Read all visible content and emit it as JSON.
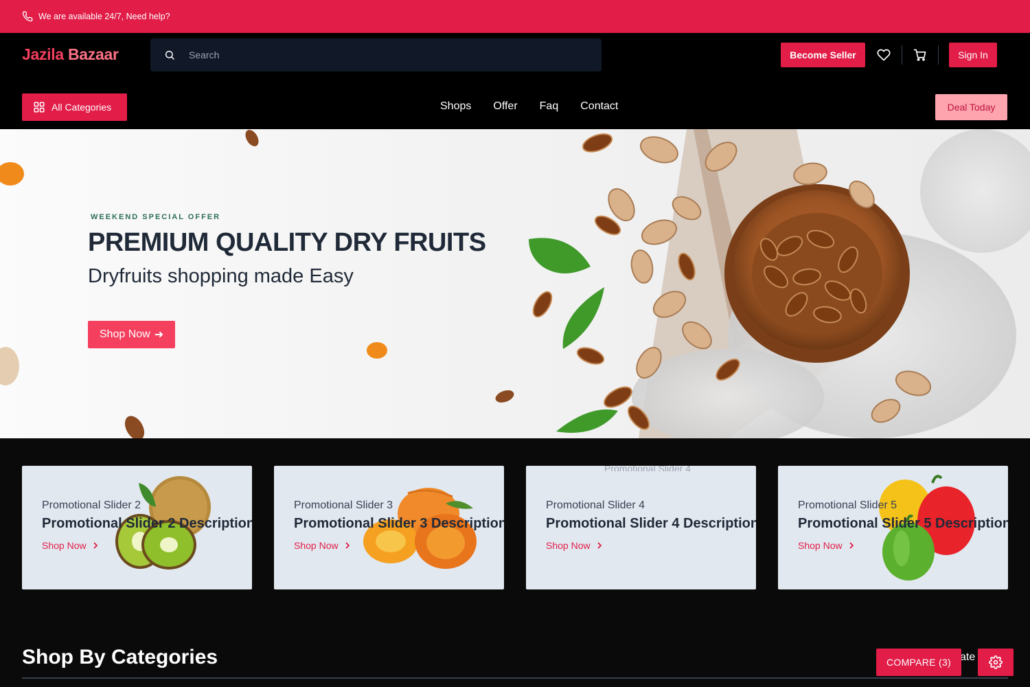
{
  "topbar": {
    "text": "We are available 24/7, Need help?",
    "icon": "phone-icon"
  },
  "header": {
    "logo_part1": "Jazila",
    "logo_part2": "Bazaar",
    "search_placeholder": "Search",
    "become_seller": "Become Seller",
    "sign_in": "Sign In",
    "icons": [
      "search-icon",
      "heart-icon",
      "cart-icon"
    ]
  },
  "nav": {
    "all_categories": "All Categories",
    "links": [
      "Shops",
      "Offer",
      "Faq",
      "Contact"
    ],
    "deal_today": "Deal Today"
  },
  "hero": {
    "eyebrow": "WEEKEND SPECIAL OFFER",
    "title": "PREMIUM QUALITY DRY FRUITS",
    "subtitle": "Dryfruits shopping made Easy",
    "cta": "Shop Now"
  },
  "promos": [
    {
      "title": "Promotional Slider 2",
      "description": "Promotional Slider 2 Description",
      "cta": "Shop Now"
    },
    {
      "title": "Promotional Slider 3",
      "description": "Promotional Slider 3 Description",
      "cta": "Shop Now"
    },
    {
      "title": "Promotional Slider 4",
      "description": "Promotional Slider 4 Description",
      "cta": "Shop Now",
      "broken_image_alt": "Promotional Slider 4"
    },
    {
      "title": "Promotional Slider 5",
      "description": "Promotional Slider 5 Description",
      "cta": "Shop Now"
    }
  ],
  "section": {
    "title": "Shop By Categories",
    "peek_text": "ate"
  },
  "floating": {
    "compare": "COMPARE (3)"
  },
  "colors": {
    "accent": "#e11d48",
    "deal_bg": "#fda4af"
  }
}
